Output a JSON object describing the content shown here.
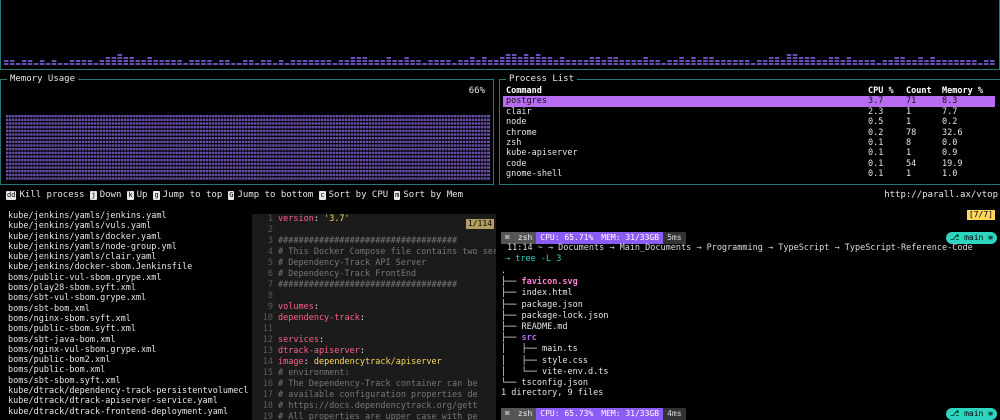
{
  "cpu_panel": {
    "graph_color": "#6b4fb8",
    "levels": [
      2,
      2,
      1,
      2,
      2,
      1,
      2,
      1,
      2,
      1,
      1,
      2,
      2,
      2,
      2,
      1,
      2,
      3,
      3,
      4,
      3,
      3,
      2,
      2,
      3,
      2,
      2,
      2,
      2,
      2,
      1,
      2,
      2,
      2,
      2,
      1,
      2,
      2,
      1,
      1,
      2,
      2,
      1,
      2,
      2,
      1,
      2,
      1,
      2,
      2,
      2,
      2,
      2,
      2,
      2,
      1,
      2,
      2,
      3,
      3,
      3,
      2,
      2,
      2,
      3,
      2,
      2,
      3,
      2,
      2,
      1,
      2,
      2,
      2,
      2,
      1,
      2,
      2,
      3,
      2,
      3,
      2,
      2,
      3,
      4,
      4,
      3,
      4,
      3,
      4,
      3,
      3,
      2,
      3,
      2,
      2,
      2,
      2,
      3,
      3,
      2,
      3,
      3,
      2,
      2,
      2,
      2,
      3,
      2,
      2,
      1,
      2,
      2,
      3,
      2,
      3,
      2,
      3,
      3,
      2,
      2,
      2,
      2,
      2,
      2,
      1,
      2,
      2,
      3,
      3,
      2,
      4,
      4,
      3,
      3,
      3,
      2,
      2,
      3,
      3,
      2,
      3,
      2,
      2,
      2,
      2,
      1,
      2,
      2,
      3,
      3,
      2,
      2,
      3,
      2,
      3,
      2,
      2,
      2,
      2,
      2,
      2,
      2,
      1,
      2,
      2
    ]
  },
  "memory_panel": {
    "title": "Memory Usage",
    "percent_label": "66%",
    "fill_fraction": 0.66,
    "bar_color": "#7b5cc9"
  },
  "process_panel": {
    "title": "Process List",
    "columns": [
      "Command",
      "CPU %",
      "Count",
      "Memory %"
    ],
    "rows": [
      {
        "cmd": "postgres",
        "cpu": "3.7",
        "count": "71",
        "mem": "8.3",
        "selected": true
      },
      {
        "cmd": "clair",
        "cpu": "2.3",
        "count": "1",
        "mem": "7.7"
      },
      {
        "cmd": "node",
        "cpu": "0.5",
        "count": "1",
        "mem": "0.2"
      },
      {
        "cmd": "chrome",
        "cpu": "0.2",
        "count": "78",
        "mem": "32.6"
      },
      {
        "cmd": "zsh",
        "cpu": "0.1",
        "count": "8",
        "mem": "0.0"
      },
      {
        "cmd": "kube-apiserver",
        "cpu": "0.1",
        "count": "1",
        "mem": "0.9"
      },
      {
        "cmd": "code",
        "cpu": "0.1",
        "count": "54",
        "mem": "19.9"
      },
      {
        "cmd": "gnome-shell",
        "cpu": "0.1",
        "count": "1",
        "mem": "1.0"
      }
    ]
  },
  "help_bar": {
    "items": [
      {
        "key": "dd",
        "label": "Kill process"
      },
      {
        "key": "j",
        "label": "Down"
      },
      {
        "key": "k",
        "label": "Up"
      },
      {
        "key": "g",
        "label": "Jump to top"
      },
      {
        "key": "G",
        "label": "Jump to bottom"
      },
      {
        "key": "c",
        "label": "Sort by CPU"
      },
      {
        "key": "m",
        "label": "Sort by Mem"
      }
    ],
    "url": "http://parall.ax/vtop"
  },
  "file_list": [
    "kube/jenkins/yamls/jenkins.yaml",
    "kube/jenkins/yamls/vuls.yaml",
    "kube/jenkins/yamls/docker.yaml",
    "kube/jenkins/yamls/node-group.yml",
    "kube/jenkins/yamls/clair.yaml",
    "kube/jenkins/docker-sbom.Jenkinsfile",
    "boms/public-vul-sbom.grype.xml",
    "boms/play28-sbom.syft.xml",
    "boms/sbt-vul-sbom.grype.xml",
    "boms/sbt-bom.xml",
    "boms/nginx-sbom.syft.xml",
    "boms/public-sbom.syft.xml",
    "boms/sbt-java-bom.xml",
    "boms/nginx-vul-sbom.grype.xml",
    "boms/public-bom2.xml",
    "boms/public-bom.xml",
    "boms/sbt-sbom.syft.xml",
    "kube/dtrack/dependency-track-persistentvolumecla..",
    "kube/dtrack/dtrack-apiserver-service.yaml",
    "kube/dtrack/dtrack-frontend-deployment.yaml"
  ],
  "editor": {
    "position": "1/114",
    "lines": [
      {
        "n": "1",
        "parts": [
          {
            "t": "version",
            "c": "k"
          },
          {
            "t": ": ",
            "c": ""
          },
          {
            "t": "'3.7'",
            "c": "s"
          }
        ]
      },
      {
        "n": "2",
        "parts": []
      },
      {
        "n": "3",
        "parts": [
          {
            "t": "###################################",
            "c": "cm"
          }
        ]
      },
      {
        "n": "4",
        "parts": [
          {
            "t": "# This Docker Compose file contains two ser",
            "c": "cm"
          }
        ]
      },
      {
        "n": "5",
        "parts": [
          {
            "t": "#    Dependency-Track API Server",
            "c": "cm"
          }
        ]
      },
      {
        "n": "6",
        "parts": [
          {
            "t": "#    Dependency-Track FrontEnd",
            "c": "cm"
          }
        ]
      },
      {
        "n": "7",
        "parts": [
          {
            "t": "###################################",
            "c": "cm"
          }
        ]
      },
      {
        "n": "8",
        "parts": []
      },
      {
        "n": "9",
        "parts": [
          {
            "t": "volumes",
            "c": "k"
          },
          {
            "t": ":",
            "c": ""
          }
        ]
      },
      {
        "n": "10",
        "parts": [
          {
            "t": "  dependency-track",
            "c": "k"
          },
          {
            "t": ":",
            "c": ""
          }
        ]
      },
      {
        "n": "11",
        "parts": []
      },
      {
        "n": "12",
        "parts": [
          {
            "t": "services",
            "c": "k"
          },
          {
            "t": ":",
            "c": ""
          }
        ]
      },
      {
        "n": "13",
        "parts": [
          {
            "t": "  dtrack-apiserver",
            "c": "k"
          },
          {
            "t": ":",
            "c": ""
          }
        ]
      },
      {
        "n": "14",
        "parts": [
          {
            "t": "    image",
            "c": "k"
          },
          {
            "t": ": ",
            "c": ""
          },
          {
            "t": "dependencytrack/apiserver",
            "c": "s"
          }
        ]
      },
      {
        "n": "15",
        "parts": [
          {
            "t": "    # environment:",
            "c": "cm"
          }
        ]
      },
      {
        "n": "16",
        "parts": [
          {
            "t": "    # The Dependency-Track container can be",
            "c": "cm"
          }
        ]
      },
      {
        "n": "17",
        "parts": [
          {
            "t": "    # available configuration properties de",
            "c": "cm"
          }
        ]
      },
      {
        "n": "18",
        "parts": [
          {
            "t": "    # https://docs.dependencytrack.org/gett",
            "c": "cm"
          }
        ]
      },
      {
        "n": "19",
        "parts": [
          {
            "t": "    # All properties are upper case with pe",
            "c": "cm"
          }
        ]
      }
    ]
  },
  "terminal": {
    "tmux_indicator": "[7/7]",
    "prompt_top": {
      "user": "zsh",
      "cpu": "CPU: 65.71%",
      "mem": "MEM: 31/33GB",
      "time": "5ms",
      "branch": "main"
    },
    "cwd_line": "11:14  ~ → Documents → Main_Documents → Programming → TypeScript → TypeScript-Reference-Code",
    "tree_cmd": "tree -L 3",
    "tree_lines": [
      {
        "prefix": ".",
        "name": "",
        "cls": ""
      },
      {
        "prefix": "├── ",
        "name": "favicon.svg",
        "cls": "svg-file"
      },
      {
        "prefix": "├── ",
        "name": "index.html",
        "cls": ""
      },
      {
        "prefix": "├── ",
        "name": "package.json",
        "cls": ""
      },
      {
        "prefix": "├── ",
        "name": "package-lock.json",
        "cls": ""
      },
      {
        "prefix": "├── ",
        "name": "README.md",
        "cls": ""
      },
      {
        "prefix": "├── ",
        "name": "src",
        "cls": "dir"
      },
      {
        "prefix": "│   ├── ",
        "name": "main.ts",
        "cls": ""
      },
      {
        "prefix": "│   ├── ",
        "name": "style.css",
        "cls": ""
      },
      {
        "prefix": "│   └── ",
        "name": "vite-env.d.ts",
        "cls": ""
      },
      {
        "prefix": "└── ",
        "name": "tsconfig.json",
        "cls": ""
      }
    ],
    "summary": "1 directory, 9 files",
    "prompt_bottom": {
      "user": "zsh",
      "cpu": "CPU: 65.73%",
      "mem": "MEM: 31/33GB",
      "time": "4ms",
      "branch": "main"
    }
  }
}
